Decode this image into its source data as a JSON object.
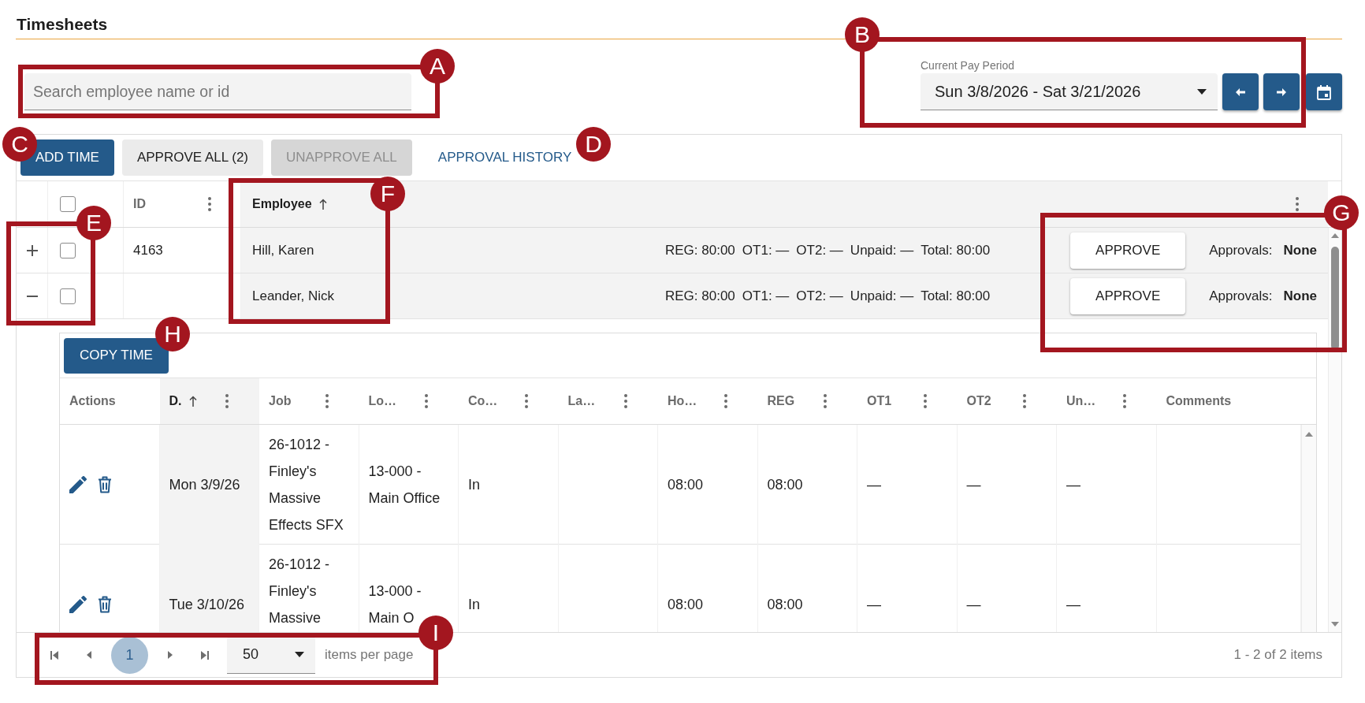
{
  "page_title": "Timesheets",
  "search": {
    "placeholder": "Search employee name or id"
  },
  "pay_period": {
    "label": "Current Pay Period",
    "value": "Sun 3/8/2026 - Sat 3/21/2026"
  },
  "toolbar": [
    {
      "label": "ADD TIME",
      "kind": "primary",
      "disabled": false
    },
    {
      "label": "APPROVE ALL (2)",
      "kind": "secondary",
      "disabled": false
    },
    {
      "label": "UNAPPROVE ALL",
      "kind": "secondary",
      "disabled": true
    },
    {
      "label": "APPROVAL HISTORY",
      "kind": "link",
      "disabled": false
    }
  ],
  "grid": {
    "select_all": {
      "checked": false
    },
    "columns": [
      {
        "label": "ID",
        "menu": true,
        "sorted": false
      },
      {
        "label": "Employee",
        "menu": true,
        "sorted": true
      }
    ],
    "rows": [
      {
        "expanded": false,
        "checked": false,
        "id": "4163",
        "name": "Hill, Karen",
        "summary": [
          "REG: 80:00",
          "OT1: —",
          "OT2: —",
          "Unpaid: —",
          "Total: 80:00"
        ],
        "action": "APPROVE",
        "approvals_label": "Approvals:",
        "approvals_value": "None"
      },
      {
        "expanded": true,
        "checked": false,
        "name": "Leander, Nick",
        "summary": [
          "REG: 80:00",
          "OT1: —",
          "OT2: —",
          "Unpaid: —",
          "Total: 80:00"
        ],
        "action": "APPROVE",
        "approvals_label": "Approvals:",
        "approvals_value": "None",
        "detail": {
          "button": "COPY TIME",
          "columns": [
            {
              "label": "Actions",
              "menu": false,
              "sorted": false
            },
            {
              "label": "D.",
              "menu": true,
              "sorted": true
            },
            {
              "label": "Job",
              "menu": true,
              "sorted": false
            },
            {
              "label": "Lo…",
              "menu": true,
              "sorted": false
            },
            {
              "label": "Co…",
              "menu": true,
              "sorted": false
            },
            {
              "label": "La…",
              "menu": true,
              "sorted": false
            },
            {
              "label": "Ho…",
              "menu": true,
              "sorted": false
            },
            {
              "label": "REG",
              "menu": true,
              "sorted": false
            },
            {
              "label": "OT1",
              "menu": true,
              "sorted": false
            },
            {
              "label": "OT2",
              "menu": true,
              "sorted": false
            },
            {
              "label": "Un…",
              "menu": true,
              "sorted": false
            },
            {
              "label": "Comments",
              "menu": false,
              "sorted": false
            }
          ],
          "rows": [
            {
              "column_2": "Mon 3/9/26",
              "job": "26-1012 - Finley's Massive Effects SFX",
              "column_4": "13-000 - Main Office",
              "column_5": "In",
              "column_7": "08:00",
              "reg": "08:00",
              "ot1": "—",
              "ot2": "—",
              "column_11": "—"
            },
            {
              "column_2": "Tue 3/10/26",
              "job": "26-1012 - Finley's Massive",
              "column_4": "13-000 - Main O",
              "column_5": "In",
              "column_7": "08:00",
              "reg": "08:00",
              "ot1": "—",
              "ot2": "—",
              "column_11": "—"
            }
          ]
        }
      }
    ]
  },
  "pager": {
    "pages": [
      {
        "label": "1",
        "selected": true
      }
    ],
    "page_size": "50",
    "page_size_label": "items per page",
    "range": "1 - 2 of 2 items"
  },
  "callouts": [
    {
      "label": "A",
      "framed": true
    },
    {
      "label": "B",
      "framed": true
    },
    {
      "label": "C",
      "framed": false
    },
    {
      "label": "D",
      "framed": false
    },
    {
      "label": "E",
      "framed": true
    },
    {
      "label": "F",
      "framed": true
    },
    {
      "label": "G",
      "framed": true
    },
    {
      "label": "H",
      "framed": false
    },
    {
      "label": "I",
      "framed": true
    }
  ]
}
